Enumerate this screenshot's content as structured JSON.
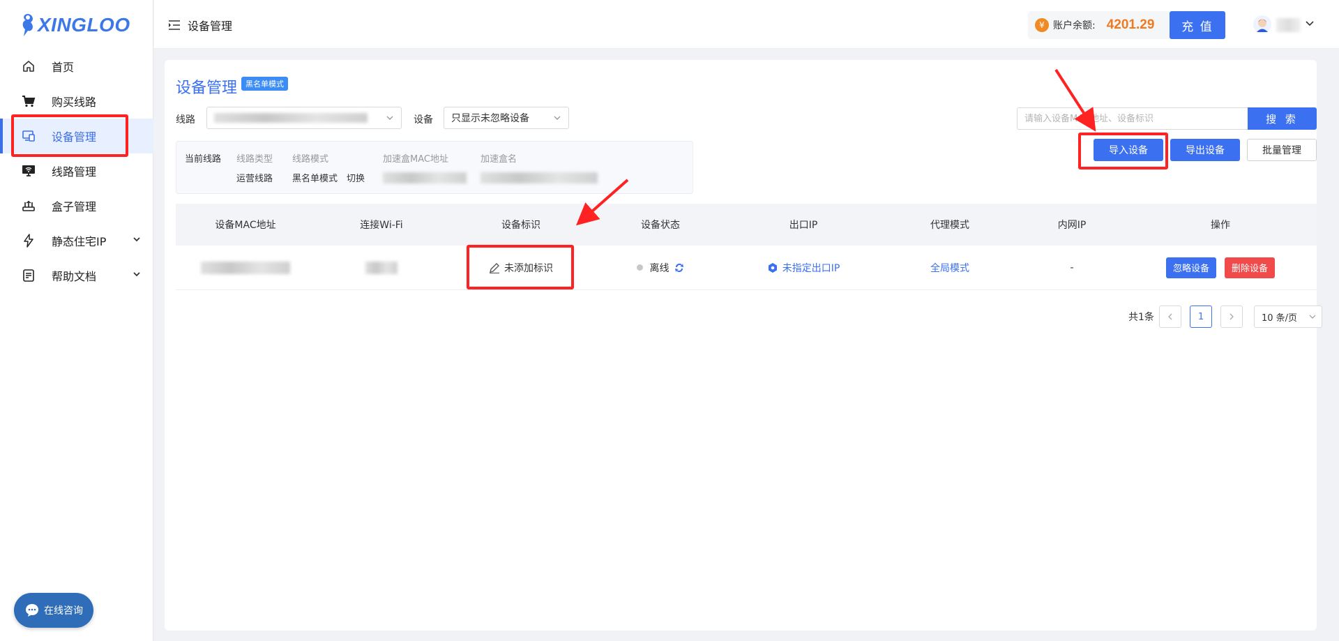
{
  "brand": {
    "name": "XINGLOO"
  },
  "sidebar": {
    "items": [
      {
        "label": "首页",
        "icon": "home-icon"
      },
      {
        "label": "购买线路",
        "icon": "cart-icon"
      },
      {
        "label": "设备管理",
        "icon": "devices-icon",
        "active": true
      },
      {
        "label": "线路管理",
        "icon": "monitor-wifi-icon"
      },
      {
        "label": "盒子管理",
        "icon": "router-icon"
      },
      {
        "label": "静态住宅IP",
        "icon": "lightning-icon",
        "expandable": true
      },
      {
        "label": "帮助文档",
        "icon": "document-icon",
        "expandable": true
      }
    ]
  },
  "header": {
    "breadcrumb": "设备管理",
    "balance_label": "账户余额:",
    "balance_value": "4201.29",
    "coin_symbol": "¥",
    "recharge_label": "充 值"
  },
  "main": {
    "title": "设备管理",
    "mode_badge": "黑名单模式",
    "filters": {
      "route_label": "线路",
      "device_label": "设备",
      "device_value": "只显示未忽略设备"
    },
    "search": {
      "placeholder": "请输入设备MAC地址、设备标识",
      "button": "搜 索"
    },
    "actions": {
      "import": "导入设备",
      "export": "导出设备",
      "batch": "批量管理"
    },
    "current_route": {
      "title": "当前线路",
      "type_label": "线路类型",
      "type_value": "运营线路",
      "mode_label": "线路模式",
      "mode_value": "黑名单模式",
      "switch_label": "切换",
      "mac_label": "加速盒MAC地址",
      "name_label": "加速盒名"
    },
    "table": {
      "columns": [
        "设备MAC地址",
        "连接Wi-Fi",
        "设备标识",
        "设备状态",
        "出口IP",
        "代理模式",
        "内网IP",
        "操作"
      ],
      "rows": [
        {
          "identifier": "未添加标识",
          "status": "离线",
          "exit_ip": "未指定出口IP",
          "proxy_mode": "全局模式",
          "lan_ip": "-",
          "ignore_btn": "忽略设备",
          "delete_btn": "删除设备"
        }
      ]
    },
    "pagination": {
      "total": "共1条",
      "current_page": "1",
      "page_size": "10 条/页"
    }
  },
  "chat": {
    "label": "在线咨询"
  },
  "colors": {
    "primary": "#3b70f0",
    "danger": "#f04a4a",
    "balance": "#ee7a22",
    "highlight": "#ff2222"
  }
}
